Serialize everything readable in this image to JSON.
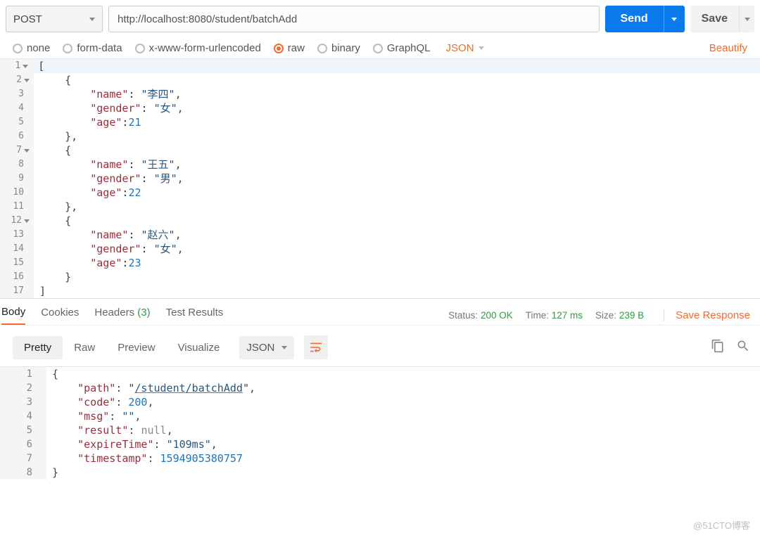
{
  "request": {
    "method": "POST",
    "url": "http://localhost:8080/student/batchAdd",
    "send_label": "Send",
    "save_label": "Save"
  },
  "body_types": {
    "options": [
      "none",
      "form-data",
      "x-www-form-urlencoded",
      "raw",
      "binary",
      "GraphQL"
    ],
    "selected": "raw",
    "content_type": "JSON",
    "beautify": "Beautify"
  },
  "request_body_lines": [
    {
      "n": "1",
      "fold": true,
      "t": "["
    },
    {
      "n": "2",
      "fold": true,
      "t": "    {"
    },
    {
      "n": "3",
      "t": "        \"name\": \"李四\","
    },
    {
      "n": "4",
      "t": "        \"gender\": \"女\","
    },
    {
      "n": "5",
      "t": "        \"age\":21"
    },
    {
      "n": "6",
      "t": "    },"
    },
    {
      "n": "7",
      "fold": true,
      "t": "    {"
    },
    {
      "n": "8",
      "t": "        \"name\": \"王五\","
    },
    {
      "n": "9",
      "t": "        \"gender\": \"男\","
    },
    {
      "n": "10",
      "t": "        \"age\":22"
    },
    {
      "n": "11",
      "t": "    },"
    },
    {
      "n": "12",
      "fold": true,
      "t": "    {"
    },
    {
      "n": "13",
      "t": "        \"name\": \"赵六\","
    },
    {
      "n": "14",
      "t": "        \"gender\": \"女\","
    },
    {
      "n": "15",
      "t": "        \"age\":23"
    },
    {
      "n": "16",
      "t": "    }"
    },
    {
      "n": "17",
      "t": "]"
    }
  ],
  "response_tabs": {
    "items": [
      "Body",
      "Cookies",
      "Headers",
      "Test Results"
    ],
    "active": "Body",
    "headers_count": "(3)"
  },
  "response_meta": {
    "status_label": "Status:",
    "status_value": "200 OK",
    "time_label": "Time:",
    "time_value": "127 ms",
    "size_label": "Size:",
    "size_value": "239 B",
    "save_response": "Save Response"
  },
  "view_modes": {
    "items": [
      "Pretty",
      "Raw",
      "Preview",
      "Visualize"
    ],
    "active": "Pretty",
    "type": "JSON"
  },
  "response_body_lines": [
    {
      "n": "1",
      "html": "<span class='punc'>{</span>"
    },
    {
      "n": "2",
      "html": "    <span class='key'>\"path\"</span><span class='punc'>: </span><span class='punc'>\"</span><span class='str-u'>/student/batchAdd</span><span class='punc'>\"</span><span class='punc'>,</span>"
    },
    {
      "n": "3",
      "html": "    <span class='key'>\"code\"</span><span class='punc'>: </span><span class='num'>200</span><span class='punc'>,</span>"
    },
    {
      "n": "4",
      "html": "    <span class='key'>\"msg\"</span><span class='punc'>: </span><span class='str'>\"\"</span><span class='punc'>,</span>"
    },
    {
      "n": "5",
      "html": "    <span class='key'>\"result\"</span><span class='punc'>: </span><span class='kw'>null</span><span class='punc'>,</span>"
    },
    {
      "n": "6",
      "html": "    <span class='key'>\"expireTime\"</span><span class='punc'>: </span><span class='str'>\"109ms\"</span><span class='punc'>,</span>"
    },
    {
      "n": "7",
      "html": "    <span class='key'>\"timestamp\"</span><span class='punc'>: </span><span class='num'>1594905380757</span>"
    },
    {
      "n": "8",
      "html": "<span class='punc'>}</span>"
    }
  ],
  "watermark": "@51CTO博客"
}
